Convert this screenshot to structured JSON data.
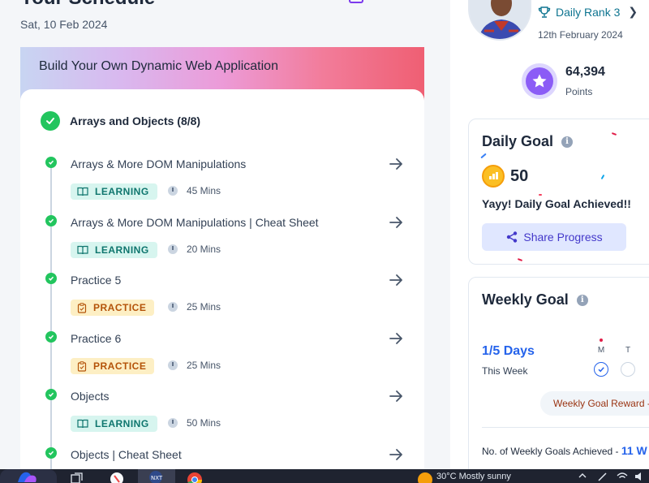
{
  "schedule": {
    "title": "Your Schedule",
    "date": "Sat, 10 Feb 2024"
  },
  "course": {
    "title": "Build Your Own Dynamic Web Application",
    "topic": "Arrays and Objects (8/8)",
    "items": [
      {
        "name": "Arrays & More DOM Manipulations",
        "type": "LEARNING",
        "duration": "45 Mins"
      },
      {
        "name": "Arrays & More DOM Manipulations | Cheat Sheet",
        "type": "LEARNING",
        "duration": "20 Mins"
      },
      {
        "name": "Practice 5",
        "type": "PRACTICE",
        "duration": "25 Mins"
      },
      {
        "name": "Practice 6",
        "type": "PRACTICE",
        "duration": "25 Mins"
      },
      {
        "name": "Objects",
        "type": "LEARNING",
        "duration": "50 Mins"
      },
      {
        "name": "Objects | Cheat Sheet",
        "type": "LEARNING",
        "duration": ""
      }
    ]
  },
  "profile": {
    "rank_label": "Daily Rank 3",
    "rank_date": "12th February 2024",
    "points_value": "64,394",
    "points_label": "Points"
  },
  "daily_goal": {
    "title": "Daily Goal",
    "coins": "50",
    "message": "Yayy! Daily Goal Achieved!!",
    "share_label": "Share Progress"
  },
  "weekly_goal": {
    "title": "Weekly Goal",
    "days": "1/5 Days",
    "period": "This Week",
    "day_labels": [
      "M",
      "T"
    ],
    "reward_label": "Weekly Goal Reward -",
    "achieved_label": "No. of Weekly Goals Achieved - ",
    "achieved_value": "11 W"
  },
  "taskbar": {
    "weather": "30°C  Mostly sunny"
  },
  "colors": {
    "accent_blue": "#2563eb",
    "success_green": "#22c55e",
    "learning_badge": "#d7f5ef",
    "practice_badge": "#fdefc4"
  }
}
